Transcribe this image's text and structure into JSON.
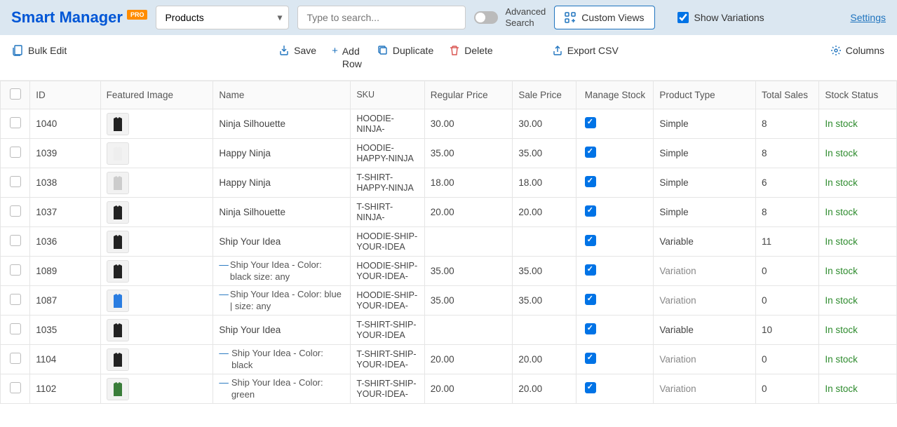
{
  "header": {
    "logo": "Smart Manager",
    "pro": "PRO",
    "dashboard_selected": "Products",
    "search_placeholder": "Type to search...",
    "advanced_search": "Advanced\nSearch",
    "custom_views": "Custom Views",
    "show_variations": "Show Variations",
    "settings": "Settings"
  },
  "toolbar": {
    "bulk_edit": "Bulk Edit",
    "save": "Save",
    "add_row": "Add\nRow",
    "duplicate": "Duplicate",
    "delete": "Delete",
    "export_csv": "Export CSV",
    "columns": "Columns"
  },
  "columns": {
    "id": "ID",
    "featured_image": "Featured Image",
    "name": "Name",
    "sku": "SKU",
    "regular_price": "Regular Price",
    "sale_price": "Sale Price",
    "manage_stock": "Manage Stock",
    "product_type": "Product Type",
    "total_sales": "Total Sales",
    "stock_status": "Stock Status"
  },
  "rows": [
    {
      "id": "1040",
      "thumb": "black",
      "name": "Ninja Silhouette",
      "variation": false,
      "sku": "HOODIE-NINJA-",
      "reg": "30.00",
      "sale": "30.00",
      "manage": true,
      "type": "Simple",
      "sales": "8",
      "stock": "In stock"
    },
    {
      "id": "1039",
      "thumb": "white",
      "name": "Happy Ninja",
      "variation": false,
      "sku": "HOODIE-HAPPY-NINJA",
      "reg": "35.00",
      "sale": "35.00",
      "manage": true,
      "type": "Simple",
      "sales": "8",
      "stock": "In stock"
    },
    {
      "id": "1038",
      "thumb": "gray",
      "name": "Happy Ninja",
      "variation": false,
      "sku": "T-SHIRT-HAPPY-NINJA",
      "reg": "18.00",
      "sale": "18.00",
      "manage": true,
      "type": "Simple",
      "sales": "6",
      "stock": "In stock"
    },
    {
      "id": "1037",
      "thumb": "black",
      "name": "Ninja Silhouette",
      "variation": false,
      "sku": "T-SHIRT-NINJA-",
      "reg": "20.00",
      "sale": "20.00",
      "manage": true,
      "type": "Simple",
      "sales": "8",
      "stock": "In stock"
    },
    {
      "id": "1036",
      "thumb": "black",
      "name": "Ship Your Idea",
      "variation": false,
      "sku": "HOODIE-SHIP-YOUR-IDEA",
      "reg": "",
      "sale": "",
      "manage": true,
      "type": "Variable",
      "sales": "11",
      "stock": "In stock"
    },
    {
      "id": "1089",
      "thumb": "black",
      "name": "Ship Your Idea - Color: black size: any",
      "variation": true,
      "sku": "HOODIE-SHIP-YOUR-IDEA-",
      "reg": "35.00",
      "sale": "35.00",
      "manage": true,
      "type": "Variation",
      "sales": "0",
      "stock": "In stock"
    },
    {
      "id": "1087",
      "thumb": "blue",
      "name": "Ship Your Idea - Color: blue | size: any",
      "variation": true,
      "sku": "HOODIE-SHIP-YOUR-IDEA-",
      "reg": "35.00",
      "sale": "35.00",
      "manage": true,
      "type": "Variation",
      "sales": "0",
      "stock": "In stock"
    },
    {
      "id": "1035",
      "thumb": "black",
      "name": "Ship Your Idea",
      "variation": false,
      "sku": "T-SHIRT-SHIP-YOUR-IDEA",
      "reg": "",
      "sale": "",
      "manage": true,
      "type": "Variable",
      "sales": "10",
      "stock": "In stock"
    },
    {
      "id": "1104",
      "thumb": "black",
      "name": "Ship Your Idea - Color: black",
      "variation": true,
      "sku": "T-SHIRT-SHIP-YOUR-IDEA-",
      "reg": "20.00",
      "sale": "20.00",
      "manage": true,
      "type": "Variation",
      "sales": "0",
      "stock": "In stock"
    },
    {
      "id": "1102",
      "thumb": "green",
      "name": "Ship Your Idea - Color: green",
      "variation": true,
      "sku": "T-SHIRT-SHIP-YOUR-IDEA-",
      "reg": "20.00",
      "sale": "20.00",
      "manage": true,
      "type": "Variation",
      "sales": "0",
      "stock": "In stock"
    }
  ],
  "thumb_colors": {
    "black": "#222",
    "white": "#eee",
    "gray": "#ccc",
    "blue": "#2a7de1",
    "green": "#3a7d3a"
  }
}
